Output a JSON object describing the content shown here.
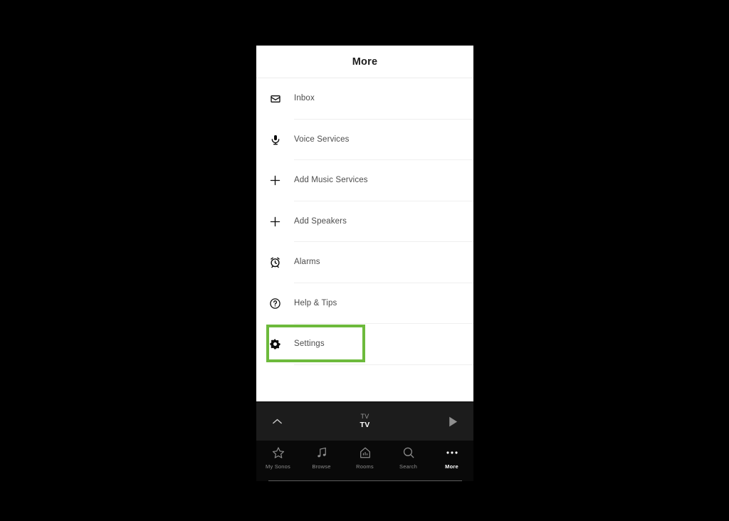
{
  "app": {
    "screen_title": "More",
    "accent_highlight_color": "#6dba3c",
    "panel_background": "#ffffff",
    "chrome_background": "#000000"
  },
  "menu": {
    "items": [
      {
        "id": "inbox",
        "label": "Inbox",
        "icon": "inbox-icon",
        "highlighted": false
      },
      {
        "id": "voice-services",
        "label": "Voice Services",
        "icon": "microphone-icon",
        "highlighted": false
      },
      {
        "id": "add-music-services",
        "label": "Add Music Services",
        "icon": "plus-icon",
        "highlighted": false
      },
      {
        "id": "add-speakers",
        "label": "Add Speakers",
        "icon": "plus-icon",
        "highlighted": false
      },
      {
        "id": "alarms",
        "label": "Alarms",
        "icon": "alarm-clock-icon",
        "highlighted": false
      },
      {
        "id": "help-and-tips",
        "label": "Help & Tips",
        "icon": "question-circle-icon",
        "highlighted": false
      },
      {
        "id": "settings",
        "label": "Settings",
        "icon": "gear-icon",
        "highlighted": true
      }
    ]
  },
  "now_playing": {
    "source": "TV",
    "track": "TV",
    "expand_icon": "chevron-up-icon",
    "play_icon": "play-icon"
  },
  "tab_bar": {
    "tabs": [
      {
        "id": "my-sonos",
        "label": "My Sonos",
        "icon": "star-icon",
        "active": false
      },
      {
        "id": "browse",
        "label": "Browse",
        "icon": "music-note-icon",
        "active": false
      },
      {
        "id": "rooms",
        "label": "Rooms",
        "icon": "house-icon",
        "active": false
      },
      {
        "id": "search",
        "label": "Search",
        "icon": "magnifier-icon",
        "active": false
      },
      {
        "id": "more",
        "label": "More",
        "icon": "ellipsis-icon",
        "active": true
      }
    ]
  }
}
